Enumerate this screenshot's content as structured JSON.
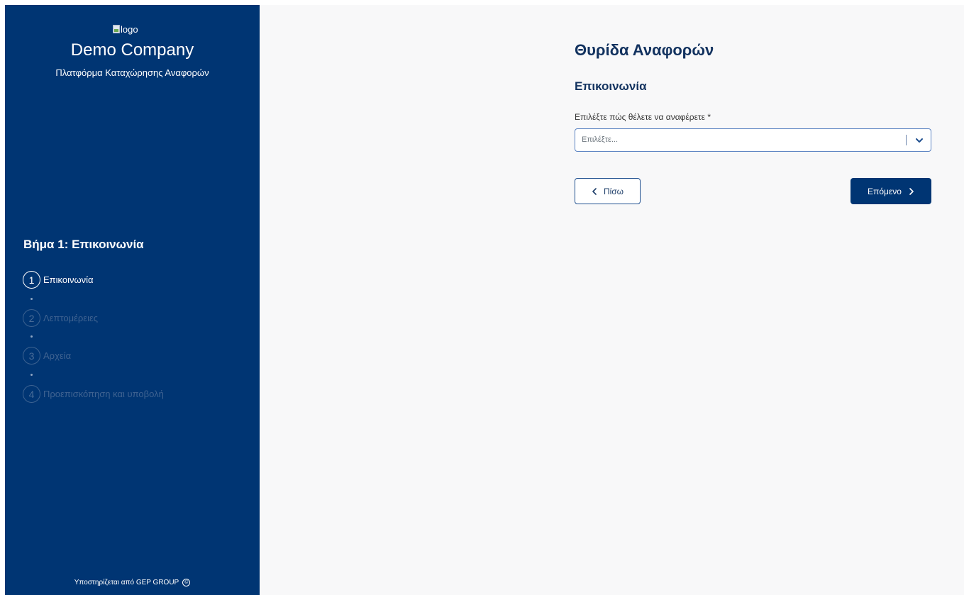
{
  "sidebar": {
    "logo_alt": "logo",
    "company_name": "Demo Company",
    "platform_subtitle": "Πλατφόρμα Καταχώρησης Αναφορών",
    "step_heading": "Βήμα 1: Επικοινωνία",
    "steps": [
      {
        "number": "1",
        "label": "Επικοινωνία",
        "state": "active"
      },
      {
        "number": "2",
        "label": "Λεπτομέρειες",
        "state": "inactive"
      },
      {
        "number": "3",
        "label": "Αρχεία",
        "state": "inactive"
      },
      {
        "number": "4",
        "label": "Προεπισκόπηση και υποβολή",
        "state": "inactive"
      }
    ],
    "footer_text": "Υποστηρίζεται από GEP GROUP",
    "footer_symbol": "©"
  },
  "main": {
    "title": "Θυρίδα Αναφορών",
    "section_title": "Επικοινωνία",
    "field_label": "Επιλέξτε πώς θέλετε να αναφέρετε *",
    "select_placeholder": "Επιλέξτε...",
    "back_label": "Πίσω",
    "next_label": "Επόμενο"
  },
  "colors": {
    "sidebar_bg": "#003573",
    "primary": "#003573",
    "heading": "#12325f",
    "page_bg": "#f8f8f9"
  },
  "icons": {
    "select_dropdown": "chevron-down-icon",
    "back": "chevron-left-icon",
    "next": "chevron-right-icon",
    "footer": "copyright-icon",
    "logo": "broken-image-icon"
  }
}
